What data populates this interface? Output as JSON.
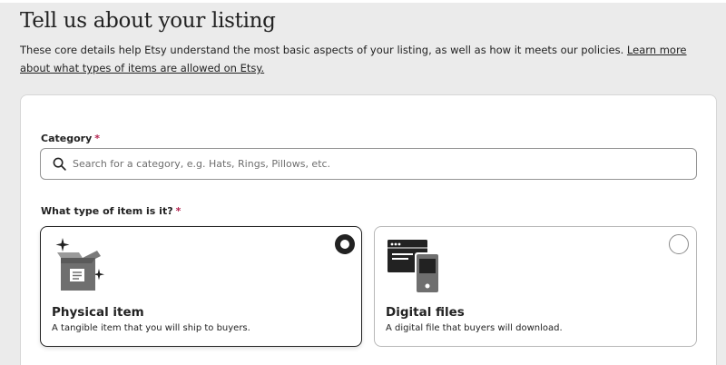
{
  "header": {
    "title": "Tell us about your listing",
    "intro_text": "These core details help Etsy understand the most basic aspects of your listing, as well as how it meets our policies. ",
    "intro_link": "Learn more about what types of items are allowed on Etsy."
  },
  "category": {
    "label": "Category",
    "required_mark": "*",
    "placeholder": "Search for a category, e.g. Hats, Rings, Pillows, etc.",
    "value": ""
  },
  "item_type": {
    "label": "What type of item is it?",
    "required_mark": "*",
    "options": [
      {
        "title": "Physical item",
        "description": "A tangible item that you will ship to buyers.",
        "icon": "box-icon",
        "selected": true
      },
      {
        "title": "Digital files",
        "description": "A digital file that buyers will download.",
        "icon": "devices-icon",
        "selected": false
      }
    ]
  },
  "colors": {
    "required": "#b3234f",
    "text": "#222222",
    "page_background": "#ebebeb"
  }
}
